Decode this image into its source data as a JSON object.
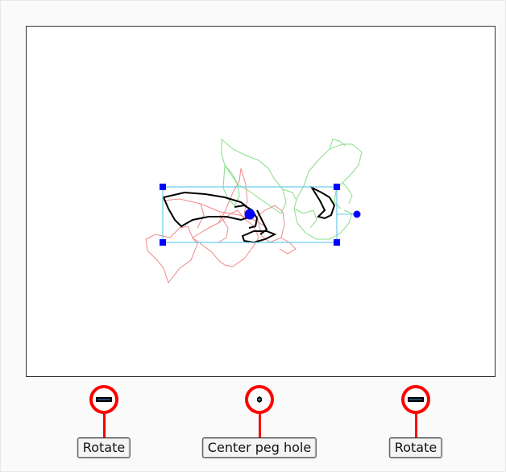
{
  "callouts": [
    {
      "label": "Rotate",
      "icon": "rotate-handle-icon"
    },
    {
      "label": "Center peg hole",
      "icon": "peg-hole-icon"
    },
    {
      "label": "Rotate",
      "icon": "rotate-handle-icon"
    }
  ],
  "colors": {
    "marker_ring": "#ff0000",
    "handle": "#0000ff",
    "bbox": "#66ccee",
    "onion_prev": "#f08888",
    "onion_next": "#88dd88",
    "drawing": "#000000"
  }
}
